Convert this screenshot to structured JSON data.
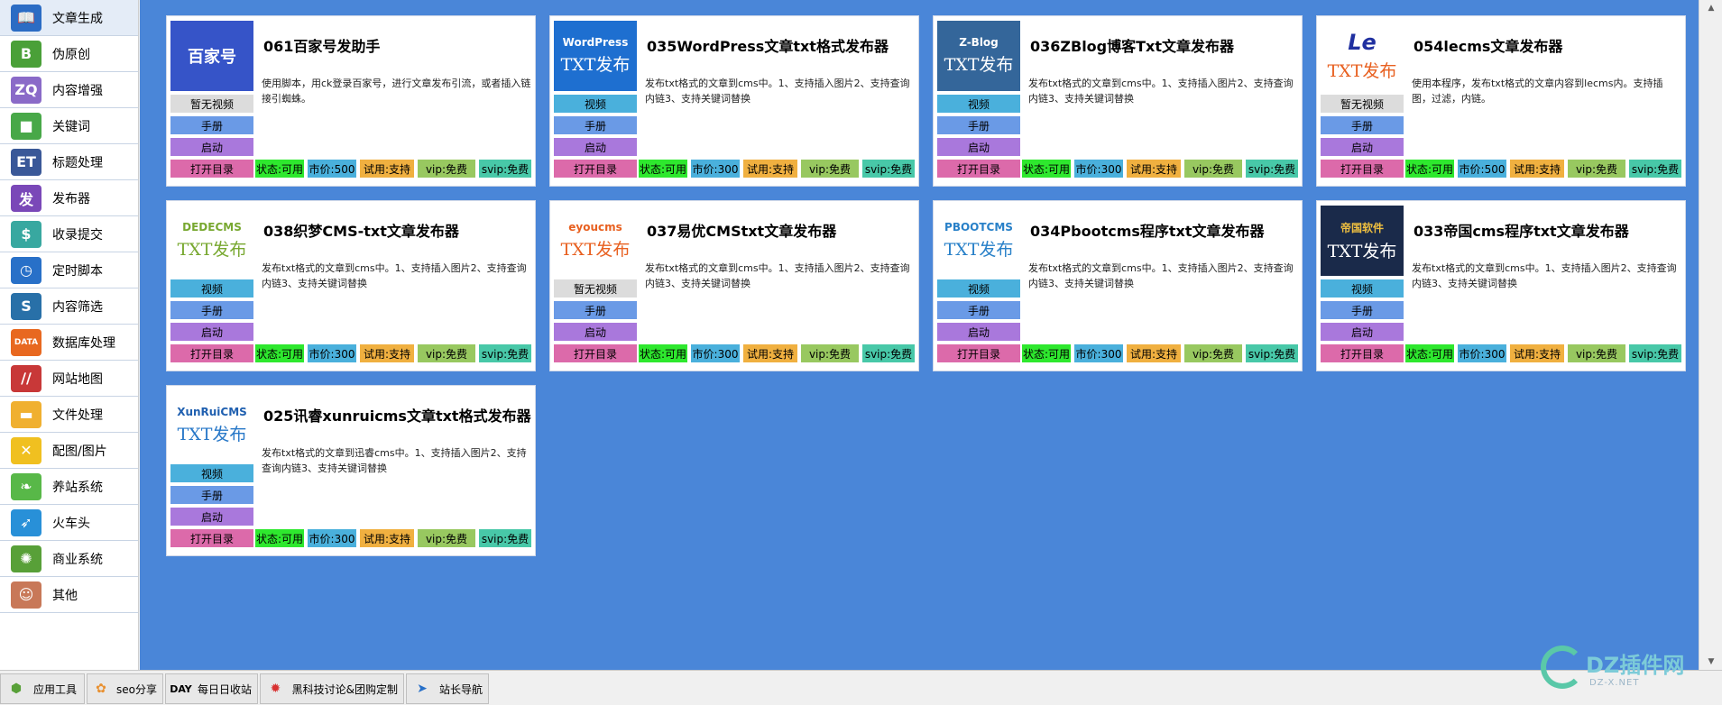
{
  "sidebar": {
    "items": [
      {
        "label": "文章生成",
        "icon": "book-icon",
        "color": "#2b6cc4",
        "glyph": "📖"
      },
      {
        "label": "伪原创",
        "icon": "document-green-icon",
        "color": "#4aa038",
        "glyph": "B"
      },
      {
        "label": "内容增强",
        "icon": "zq-icon",
        "color": "#8a6ac8",
        "glyph": "ZQ"
      },
      {
        "label": "关键词",
        "icon": "green-cube-icon",
        "color": "#48a848",
        "glyph": "■"
      },
      {
        "label": "标题处理",
        "icon": "et-icon",
        "color": "#3a5898",
        "glyph": "ET"
      },
      {
        "label": "发布器",
        "icon": "publish-icon",
        "color": "#7a48b8",
        "glyph": "发"
      },
      {
        "label": "收录提交",
        "icon": "submit-icon",
        "color": "#38a8a0",
        "glyph": "$"
      },
      {
        "label": "定时脚本",
        "icon": "timer-icon",
        "color": "#2870c8",
        "glyph": "◷"
      },
      {
        "label": "内容筛选",
        "icon": "filter-icon",
        "color": "#2870a8",
        "glyph": "S"
      },
      {
        "label": "数据库处理",
        "icon": "database-icon",
        "color": "#e86820",
        "glyph": "DATA"
      },
      {
        "label": "网站地图",
        "icon": "sitemap-icon",
        "color": "#c83838",
        "glyph": "∕∕"
      },
      {
        "label": "文件处理",
        "icon": "folder-icon",
        "color": "#f0b030",
        "glyph": "▬"
      },
      {
        "label": "配图/图片",
        "icon": "image-icon",
        "color": "#f0c020",
        "glyph": "✕"
      },
      {
        "label": "养站系统",
        "icon": "leaf-icon",
        "color": "#58b848",
        "glyph": "❧"
      },
      {
        "label": "火车头",
        "icon": "train-icon",
        "color": "#2890d8",
        "glyph": "➶"
      },
      {
        "label": "商业系统",
        "icon": "business-icon",
        "color": "#58a038",
        "glyph": "✺"
      },
      {
        "label": "其他",
        "icon": "avatar-icon",
        "color": "#c87858",
        "glyph": "☺"
      }
    ]
  },
  "cards": [
    {
      "title": "061百家号发助手",
      "logo_top": "百家号",
      "logo_bottom": "",
      "logo_bg": "#3654c8",
      "logo_top_color": "#ffffff",
      "logo_bottom_color": "#ffffff",
      "video": "暂无视频",
      "has_video": false,
      "desc": "使用脚本，用ck登录百家号，进行文章发布引流，或者插入链接引蜘蛛。",
      "price": "市价:500"
    },
    {
      "title": "035WordPress文章txt格式发布器",
      "logo_top": "WordPress",
      "logo_bottom": "TXT发布",
      "logo_bg": "#1e6fd0",
      "logo_top_color": "#ffffff",
      "logo_bottom_color": "#ffffff",
      "video": "视频",
      "has_video": true,
      "desc": "发布txt格式的文章到cms中。1、支持插入图片2、支持查询内链3、支持关键词替换",
      "price": "市价:300"
    },
    {
      "title": "036ZBlog博客Txt文章发布器",
      "logo_top": "Z-Blog",
      "logo_bottom": "TXT发布",
      "logo_bg": "#34669a",
      "logo_top_color": "#ffffff",
      "logo_bottom_color": "#ffffff",
      "video": "视频",
      "has_video": true,
      "desc": "发布txt格式的文章到cms中。1、支持插入图片2、支持查询内链3、支持关键词替换",
      "price": "市价:300"
    },
    {
      "title": "054lecms文章发布器",
      "logo_top": "Le",
      "logo_bottom": "TXT发布",
      "logo_bg": "#ffffff",
      "logo_top_color": "#2030a0",
      "logo_bottom_color": "#e86020",
      "video": "暂无视频",
      "has_video": false,
      "desc": "使用本程序，发布txt格式的文章内容到lecms内。支持插图，过滤，内链。",
      "price": "市价:500"
    },
    {
      "title": "038织梦CMS-txt文章发布器",
      "logo_top": "DEDECMS",
      "logo_bottom": "TXT发布",
      "logo_bg": "#ffffff",
      "logo_top_color": "#78a830",
      "logo_bottom_color": "#78a830",
      "video": "视频",
      "has_video": true,
      "desc": "发布txt格式的文章到cms中。1、支持插入图片2、支持查询内链3、支持关键词替换",
      "price": "市价:300"
    },
    {
      "title": "037易优CMStxt文章发布器",
      "logo_top": "eyoucms",
      "logo_bottom": "TXT发布",
      "logo_bg": "#ffffff",
      "logo_top_color": "#e86020",
      "logo_bottom_color": "#e86020",
      "video": "暂无视频",
      "has_video": false,
      "desc": "发布txt格式的文章到cms中。1、支持插入图片2、支持查询内链3、支持关键词替换",
      "price": "市价:300"
    },
    {
      "title": "034Pbootcms程序txt文章发布器",
      "logo_top": "PBOOTCMS",
      "logo_bottom": "TXT发布",
      "logo_bg": "#ffffff",
      "logo_top_color": "#2880c8",
      "logo_bottom_color": "#2880c8",
      "video": "视频",
      "has_video": true,
      "desc": "发布txt格式的文章到cms中。1、支持插入图片2、支持查询内链3、支持关键词替换",
      "price": "市价:300"
    },
    {
      "title": "033帝国cms程序txt文章发布器",
      "logo_top": "帝国软件",
      "logo_bottom": "TXT发布",
      "logo_bg": "#1a2a4a",
      "logo_top_color": "#f0c040",
      "logo_bottom_color": "#ffffff",
      "video": "视频",
      "has_video": true,
      "desc": "发布txt格式的文章到cms中。1、支持插入图片2、支持查询内链3、支持关键词替换",
      "price": "市价:300"
    },
    {
      "title": "025讯睿xunruicms文章txt格式发布器",
      "logo_top": "XunRuiCMS",
      "logo_bottom": "TXT发布",
      "logo_bg": "#ffffff",
      "logo_top_color": "#2060b0",
      "logo_bottom_color": "#2878c8",
      "video": "视频",
      "has_video": true,
      "desc": "发布txt格式的文章到迅睿cms中。1、支持插入图片2、支持查询内链3、支持关键词替换",
      "price": "市价:300"
    }
  ],
  "card_common": {
    "manual": "手册",
    "start": "启动",
    "open_dir": "打开目录",
    "status": "状态:可用",
    "trial": "试用:支持",
    "vip": "vip:免费",
    "svip": "svip:免费"
  },
  "tag_colors": {
    "status": "#2ee82e",
    "price": "#4ab0dc",
    "trial": "#f0b040",
    "vip": "#98c860",
    "svip": "#48c8a8"
  },
  "taskbar": {
    "tabs": [
      {
        "label": "应用工具",
        "icon": "app-tools-icon",
        "glyph": "⬢",
        "color": "#58a038"
      },
      {
        "label": "seo分享",
        "icon": "seo-share-icon",
        "glyph": "✿",
        "color": "#e89030"
      },
      {
        "label": "每日日收站",
        "icon": "day-icon",
        "glyph": "DAY",
        "color": "#000000"
      },
      {
        "label": "黑科技讨论&团购定制",
        "icon": "gear-red-icon",
        "glyph": "✹",
        "color": "#d83030"
      },
      {
        "label": "站长导航",
        "icon": "navigation-arrow-icon",
        "glyph": "➤",
        "color": "#2870c8"
      }
    ]
  },
  "watermark": {
    "main": "DZ插件网",
    "sub": "DZ-X.NET"
  }
}
